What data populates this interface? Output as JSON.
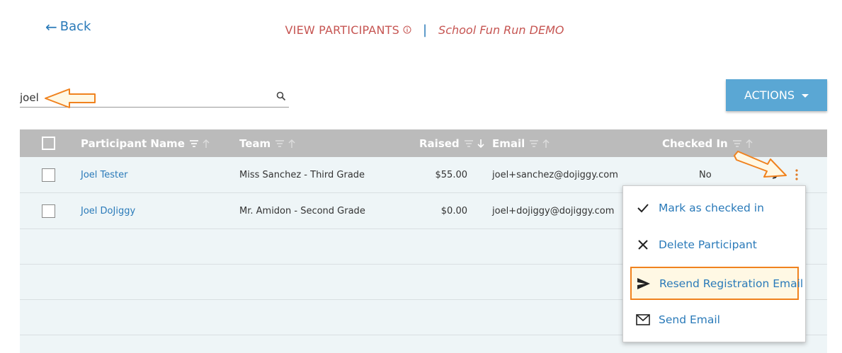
{
  "nav": {
    "back_label": "Back"
  },
  "header": {
    "title": "VIEW PARTICIPANTS",
    "separator": "|",
    "event_name": "School Fun Run DEMO"
  },
  "search": {
    "value": "joel",
    "placeholder": ""
  },
  "actions": {
    "label": "ACTIONS"
  },
  "table": {
    "columns": [
      "Participant Name",
      "Team",
      "Raised",
      "Email",
      "Checked In"
    ],
    "rows": [
      {
        "name": "Joel Tester",
        "team": "Miss Sanchez - Third Grade",
        "raised": "$55.00",
        "email": "joel+sanchez@dojiggy.com",
        "checked_in": "No"
      },
      {
        "name": "Joel DoJiggy",
        "team": "Mr. Amidon - Second Grade",
        "raised": "$0.00",
        "email": "joel+dojiggy@dojiggy.com",
        "checked_in": ""
      }
    ]
  },
  "row_menu": {
    "items": [
      {
        "label": "Mark as checked in",
        "icon": "check-icon"
      },
      {
        "label": "Delete Participant",
        "icon": "close-icon"
      },
      {
        "label": "Resend Registration Email",
        "icon": "send-icon"
      },
      {
        "label": "Send Email",
        "icon": "envelope-icon"
      }
    ]
  },
  "colors": {
    "link": "#2a7ab9",
    "title": "#c65552",
    "actions_button": "#5aa7d4",
    "header_bg": "#bbbbbb",
    "table_bg": "#eef5f7",
    "callout": "#f0821e"
  }
}
